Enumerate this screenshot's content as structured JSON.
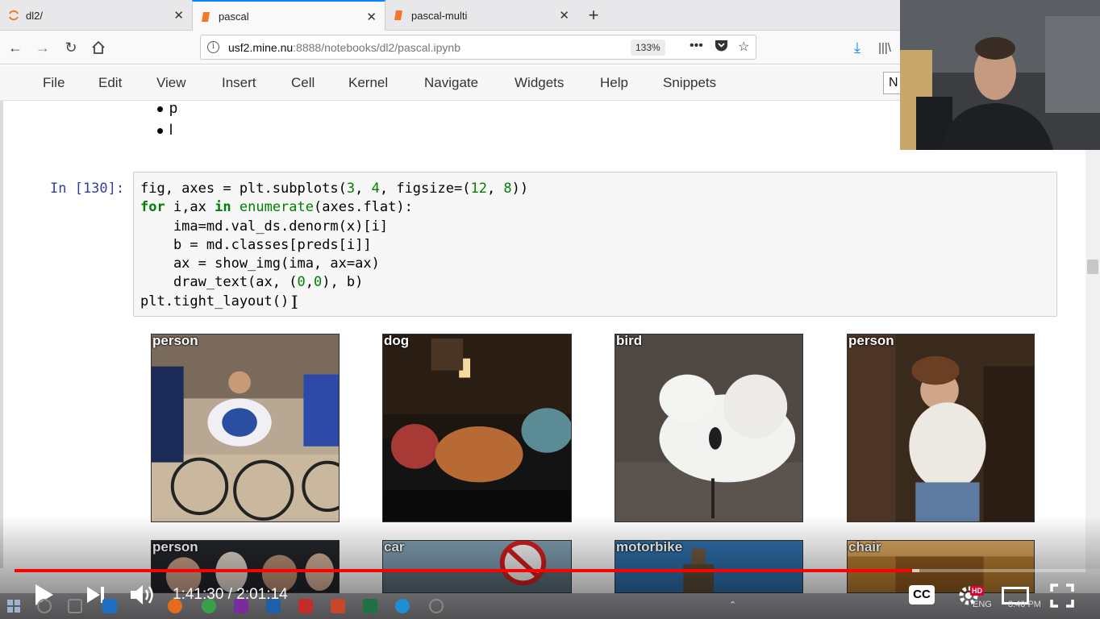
{
  "browser": {
    "tabs": [
      {
        "label": "dl2/",
        "active": false
      },
      {
        "label": "pascal",
        "active": true
      },
      {
        "label": "pascal-multi",
        "active": false
      }
    ],
    "url_host": "usf2.mine.nu",
    "url_path": ":8888/notebooks/dl2/pascal.ipynb",
    "zoom": "133%"
  },
  "jupyter": {
    "menu": [
      "File",
      "Edit",
      "View",
      "Insert",
      "Cell",
      "Kernel",
      "Navigate",
      "Widgets",
      "Help",
      "Snippets"
    ],
    "kernel_box": "N",
    "bullets": [
      "p",
      "l"
    ],
    "prompt": "In [130]:",
    "code_lines": [
      "fig, axes = plt.subplots(3, 4, figsize=(12, 8))",
      "for i,ax in enumerate(axes.flat):",
      "    ima=md.val_ds.denorm(x)[i]",
      "    b = md.classes[preds[i]]",
      "    ax = show_img(ima, ax=ax)",
      "    draw_text(ax, (0,0), b)",
      "plt.tight_layout()"
    ],
    "image_labels": [
      "person",
      "dog",
      "bird",
      "person",
      "person",
      "car",
      "motorbike",
      "chair"
    ]
  },
  "player": {
    "time_current": "1:41:30",
    "time_total": "2:01:14",
    "progress_fraction": 0.838,
    "loaded_fraction": 0.845,
    "cc_label": "CC",
    "hd_badge": "HD"
  },
  "taskbar": {
    "lang": "ENG",
    "clock": "8:40 PM"
  },
  "colors": {
    "progress": "#ff0000",
    "tab_accent": "#0a84ff",
    "prompt": "#303f9f",
    "keyword": "#008000"
  }
}
